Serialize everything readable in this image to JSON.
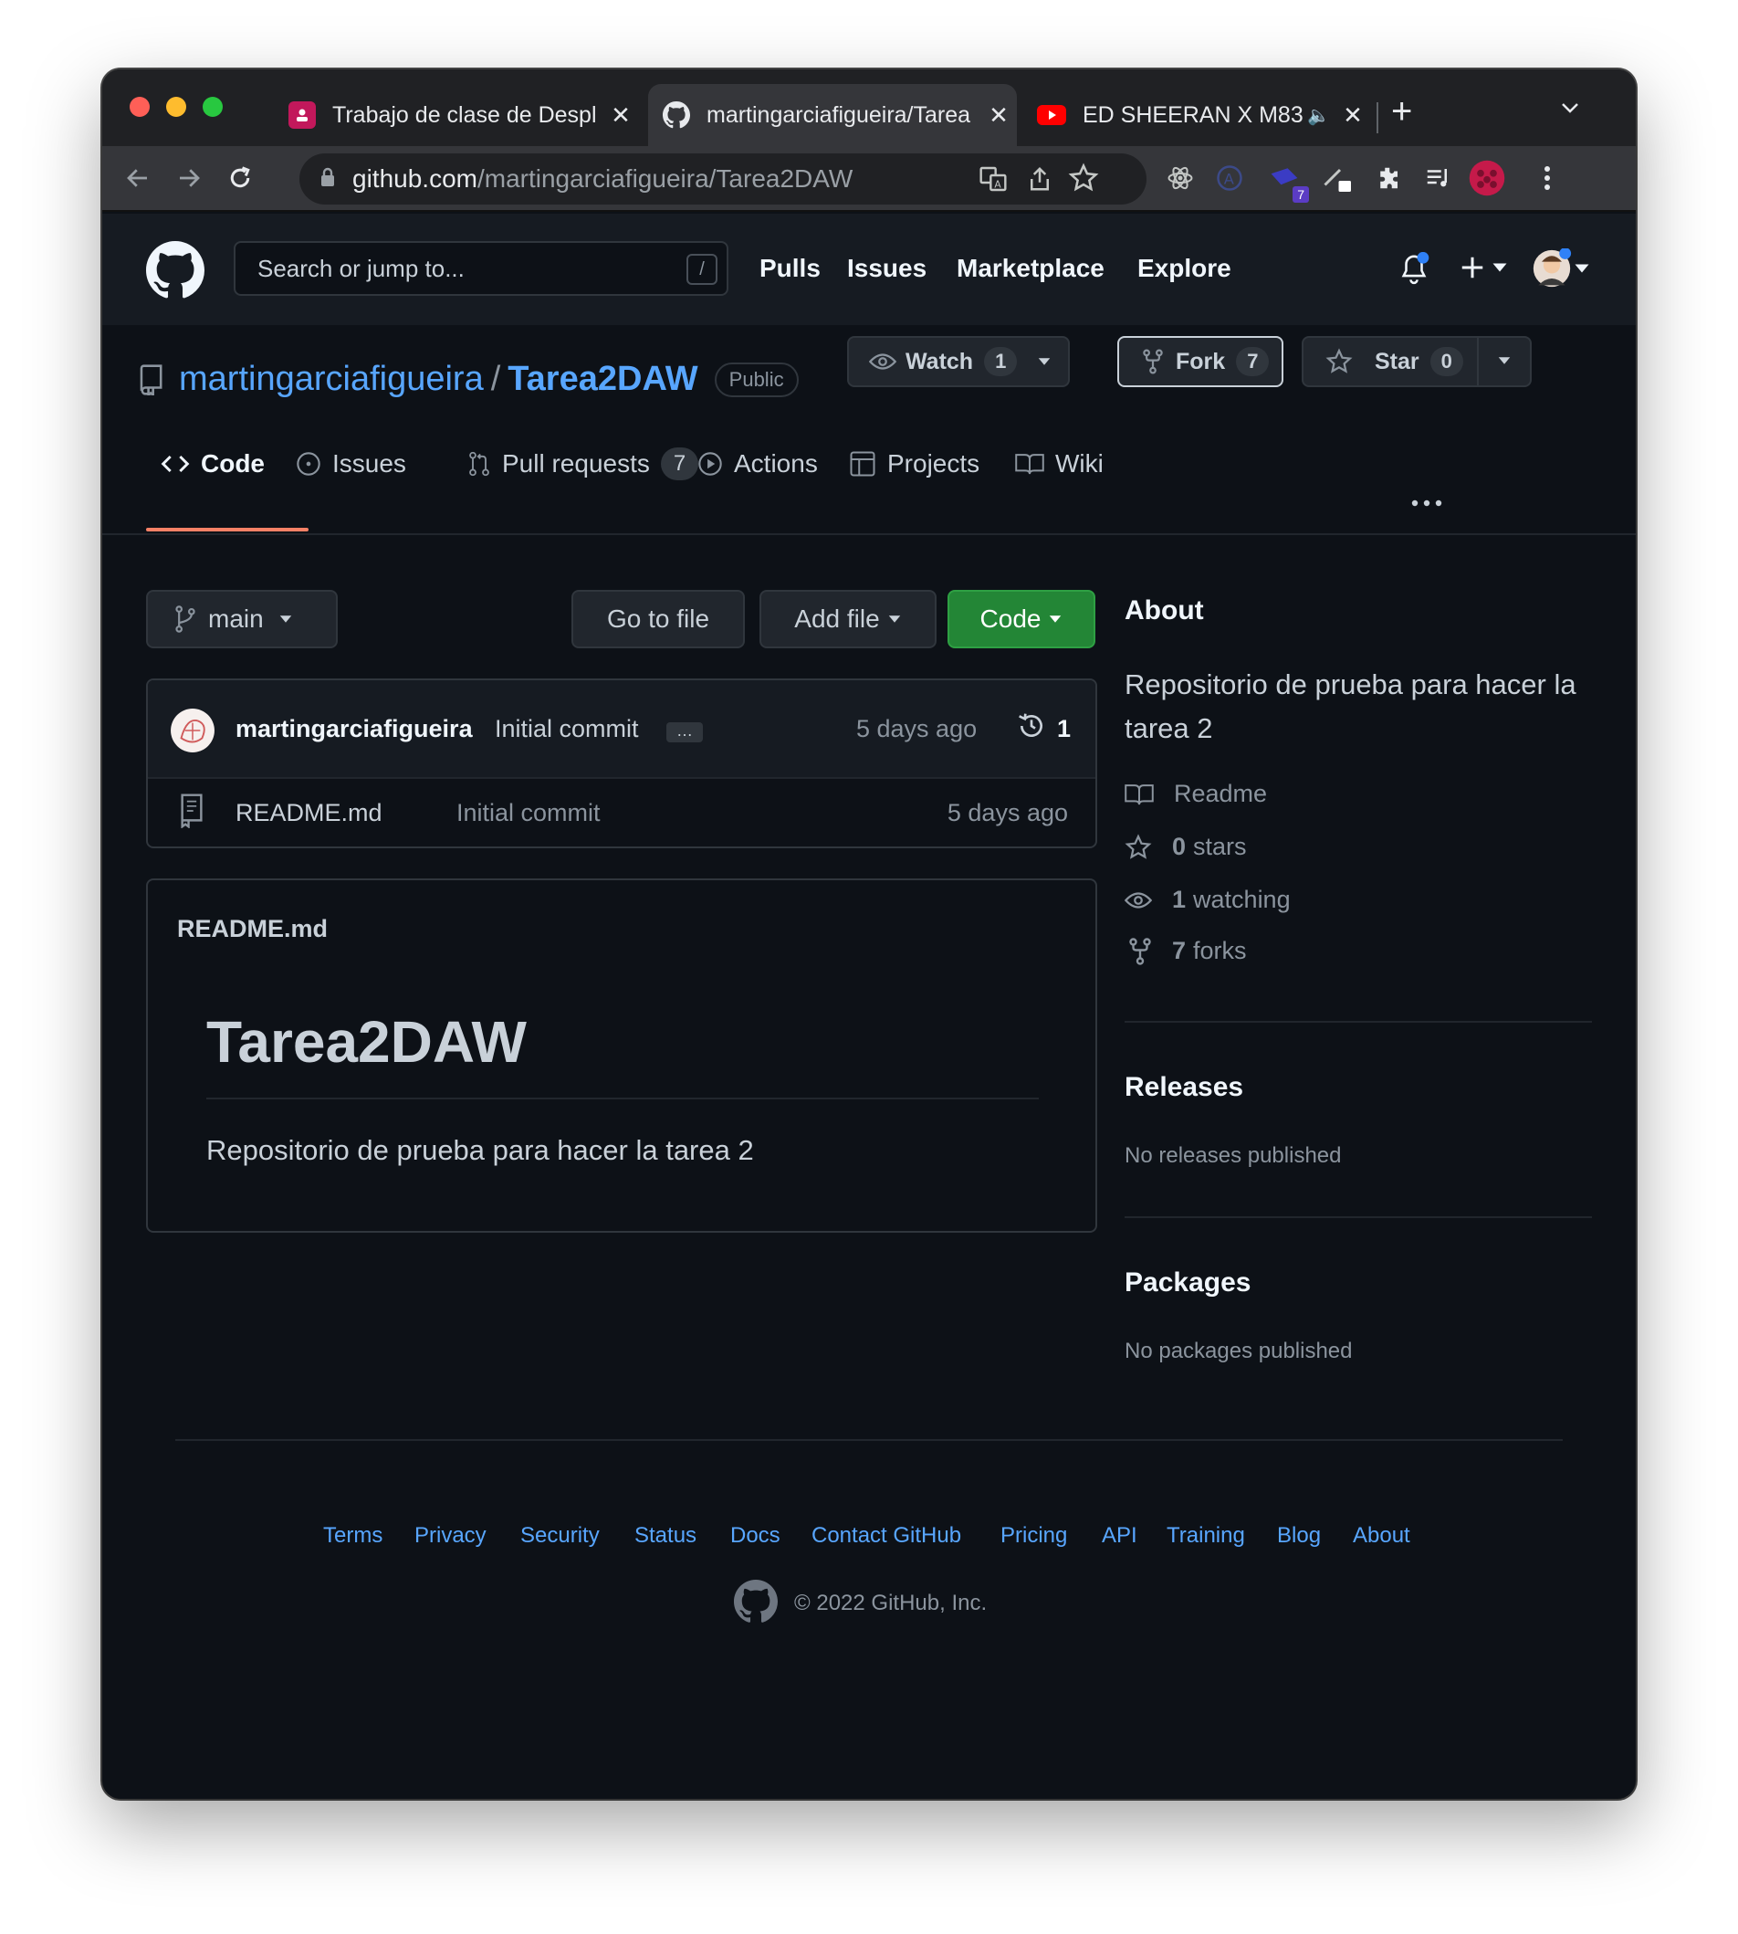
{
  "browser": {
    "tabs": [
      {
        "title": "Trabajo de clase de Despl",
        "close": "✕"
      },
      {
        "title": "martingarciafigueira/Tarea",
        "close": "✕"
      },
      {
        "title": "ED SHEERAN X M83",
        "close": "✕"
      }
    ],
    "new_tab": "+",
    "url_host": "github.com",
    "url_path": "/martingarciafigueira/Tarea2DAW",
    "extension_badge": "7"
  },
  "header": {
    "search_placeholder": "Search or jump to...",
    "search_shortcut": "/",
    "nav": [
      "Pulls",
      "Issues",
      "Marketplace",
      "Explore"
    ]
  },
  "repo": {
    "owner": "martingarciafigueira",
    "separator": "/",
    "name": "Tarea2DAW",
    "visibility": "Public",
    "watch_label": "Watch",
    "watch_count": "1",
    "fork_label": "Fork",
    "fork_count": "7",
    "star_label": "Star",
    "star_count": "0"
  },
  "tabs": {
    "code": "Code",
    "issues": "Issues",
    "pulls": "Pull requests",
    "pulls_count": "7",
    "actions": "Actions",
    "projects": "Projects",
    "wiki": "Wiki"
  },
  "toolbar": {
    "branch": "main",
    "go_to_file": "Go to file",
    "add_file": "Add file",
    "code": "Code"
  },
  "commit": {
    "author": "martingarciafigueira",
    "message": "Initial commit",
    "ellipsis": "…",
    "time": "5 days ago",
    "count": "1"
  },
  "files": [
    {
      "name": "README.md",
      "message": "Initial commit",
      "time": "5 days ago"
    }
  ],
  "readme": {
    "filename": "README.md",
    "heading": "Tarea2DAW",
    "body": "Repositorio de prueba para hacer la tarea 2"
  },
  "about": {
    "title": "About",
    "description": "Repositorio de prueba para hacer la tarea 2",
    "readme": "Readme",
    "stars_num": "0",
    "stars_label": "stars",
    "watching_num": "1",
    "watching_label": "watching",
    "forks_num": "7",
    "forks_label": "forks"
  },
  "releases": {
    "title": "Releases",
    "text": "No releases published"
  },
  "packages": {
    "title": "Packages",
    "text": "No packages published"
  },
  "footer": {
    "links": [
      "Terms",
      "Privacy",
      "Security",
      "Status",
      "Docs",
      "Contact GitHub",
      "Pricing",
      "API",
      "Training",
      "Blog",
      "About"
    ],
    "copyright": "© 2022 GitHub, Inc."
  },
  "colors": {
    "accent_blue": "#58a6ff",
    "code_button_green": "#238636",
    "active_tab_underline": "#f78166",
    "background": "#0d1117"
  }
}
